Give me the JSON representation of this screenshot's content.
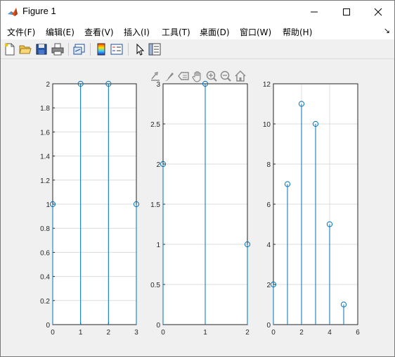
{
  "window": {
    "title": "Figure 1",
    "controls": [
      "minimize",
      "maximize",
      "close"
    ]
  },
  "menu": {
    "items": [
      "文件(F)",
      "编辑(E)",
      "查看(V)",
      "插入(I)",
      "工具(T)",
      "桌面(D)",
      "窗口(W)",
      "帮助(H)"
    ],
    "overflow_arrow": "↘"
  },
  "toolbar": {
    "buttons": [
      "new-figure-icon",
      "open-file-icon",
      "save-icon",
      "print-icon",
      "link-plot-icon",
      "insert-colorbar-icon",
      "insert-legend-icon",
      "edit-plot-arrow-icon",
      "property-inspector-icon"
    ]
  },
  "axes_toolbar": {
    "buttons": [
      "export-icon",
      "brush-icon",
      "data-tips-icon",
      "pan-hand-icon",
      "zoom-in-icon",
      "zoom-out-icon",
      "home-icon"
    ]
  },
  "colors": {
    "stem": "#0072bd",
    "grid": "#dcdcdc",
    "axis": "#262626"
  },
  "chart_data": [
    {
      "type": "scatter",
      "style": "stem",
      "x": [
        0,
        1,
        2,
        3
      ],
      "y": [
        1,
        2,
        2,
        1
      ],
      "xlim": [
        0,
        3
      ],
      "ylim": [
        0,
        2
      ],
      "xticks": [
        "0",
        "1",
        "2",
        "3"
      ],
      "yticks": [
        "0",
        "0.2",
        "0.4",
        "0.6",
        "0.8",
        "1",
        "1.2",
        "1.4",
        "1.6",
        "1.8",
        "2"
      ],
      "grid": true
    },
    {
      "type": "scatter",
      "style": "stem",
      "x": [
        0,
        1,
        2
      ],
      "y": [
        2,
        3,
        1
      ],
      "xlim": [
        0,
        2
      ],
      "ylim": [
        0,
        3
      ],
      "xticks": [
        "0",
        "1",
        "2"
      ],
      "yticks": [
        "0",
        "0.5",
        "1",
        "1.5",
        "2",
        "2.5",
        "3"
      ],
      "grid": true
    },
    {
      "type": "scatter",
      "style": "stem",
      "x": [
        0,
        1,
        2,
        3,
        4,
        5
      ],
      "y": [
        2,
        7,
        11,
        10,
        5,
        1
      ],
      "xlim": [
        0,
        6
      ],
      "ylim": [
        0,
        12
      ],
      "xticks": [
        "0",
        "2",
        "4",
        "6"
      ],
      "yticks": [
        "0",
        "2",
        "4",
        "6",
        "8",
        "10",
        "12"
      ],
      "grid": true
    }
  ]
}
